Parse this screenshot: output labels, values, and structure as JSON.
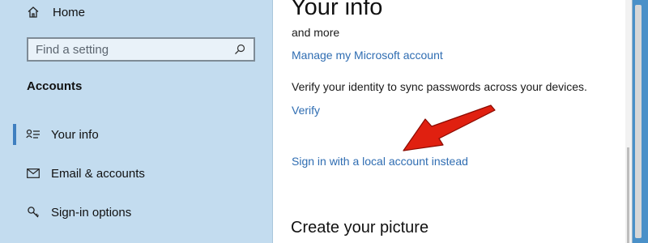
{
  "sidebar": {
    "home_label": "Home",
    "search_placeholder": "Find a setting",
    "section_title": "Accounts",
    "items": [
      {
        "label": "Your info",
        "icon": "person-card-icon",
        "active": true
      },
      {
        "label": "Email & accounts",
        "icon": "mail-icon",
        "active": false
      },
      {
        "label": "Sign-in options",
        "icon": "key-icon",
        "active": false
      }
    ]
  },
  "main": {
    "title": "Your info",
    "partial_text": "and more",
    "manage_link": "Manage my Microsoft account",
    "verify_text": "Verify your identity to sync passwords across your devices.",
    "verify_link": "Verify",
    "local_account_link": "Sign in with a local account instead",
    "picture_section_title": "Create your picture"
  },
  "colors": {
    "sidebar_bg": "#c3dcef",
    "accent": "#3f7fc0",
    "link": "#2f6db2",
    "annotation_arrow": "#e02010"
  }
}
